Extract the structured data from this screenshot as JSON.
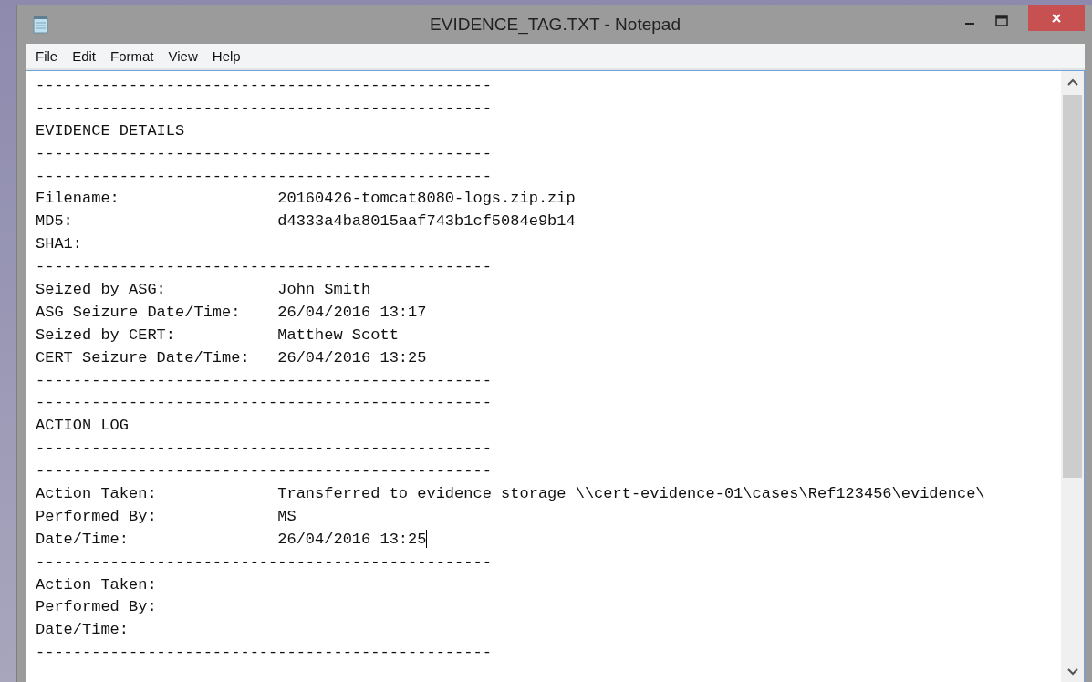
{
  "window": {
    "title": "EVIDENCE_TAG.TXT - Notepad"
  },
  "menu": [
    "File",
    "Edit",
    "Format",
    "View",
    "Help"
  ],
  "lines": [
    {
      "kind": "rule",
      "text": "-------------------------------------------------"
    },
    {
      "kind": "rule",
      "text": "-------------------------------------------------"
    },
    {
      "kind": "heading",
      "text": "EVIDENCE DETAILS"
    },
    {
      "kind": "rule",
      "text": "-------------------------------------------------"
    },
    {
      "kind": "rule",
      "text": "-------------------------------------------------"
    },
    {
      "kind": "field",
      "label": "Filename:",
      "value": "20160426-tomcat8080-logs.zip.zip",
      "caret": false
    },
    {
      "kind": "field",
      "label": "MD5:",
      "value": "d4333a4ba8015aaf743b1cf5084e9b14",
      "caret": false
    },
    {
      "kind": "field",
      "label": "SHA1:",
      "caret": false
    },
    {
      "kind": "rule",
      "text": "-------------------------------------------------"
    },
    {
      "kind": "field",
      "label": "Seized by ASG:",
      "value": "John Smith",
      "caret": false
    },
    {
      "kind": "field",
      "label": "ASG Seizure Date/Time:",
      "value": "26/04/2016 13:17",
      "caret": false
    },
    {
      "kind": "field",
      "label": "Seized by CERT:",
      "value": "Matthew Scott",
      "caret": false
    },
    {
      "kind": "field",
      "label": "CERT Seizure Date/Time:",
      "value": "26/04/2016 13:25",
      "caret": false
    },
    {
      "kind": "rule",
      "text": "-------------------------------------------------"
    },
    {
      "kind": "rule",
      "text": "-------------------------------------------------"
    },
    {
      "kind": "heading",
      "text": "ACTION LOG"
    },
    {
      "kind": "rule",
      "text": "-------------------------------------------------"
    },
    {
      "kind": "rule",
      "text": "-------------------------------------------------"
    },
    {
      "kind": "field",
      "label": "Action Taken:",
      "value": "Transferred to evidence storage \\\\cert-evidence-01\\cases\\Ref123456\\evidence\\",
      "caret": false
    },
    {
      "kind": "field",
      "label": "Performed By:",
      "value": "MS",
      "caret": false
    },
    {
      "kind": "field",
      "label": "Date/Time:",
      "value": "26/04/2016 13:25",
      "caret": true
    },
    {
      "kind": "rule",
      "text": "-------------------------------------------------"
    },
    {
      "kind": "field",
      "label": "Action Taken:",
      "caret": false
    },
    {
      "kind": "field",
      "label": "Performed By:",
      "caret": false
    },
    {
      "kind": "field",
      "label": "Date/Time:",
      "caret": false
    },
    {
      "kind": "rule",
      "text": "-------------------------------------------------"
    }
  ]
}
